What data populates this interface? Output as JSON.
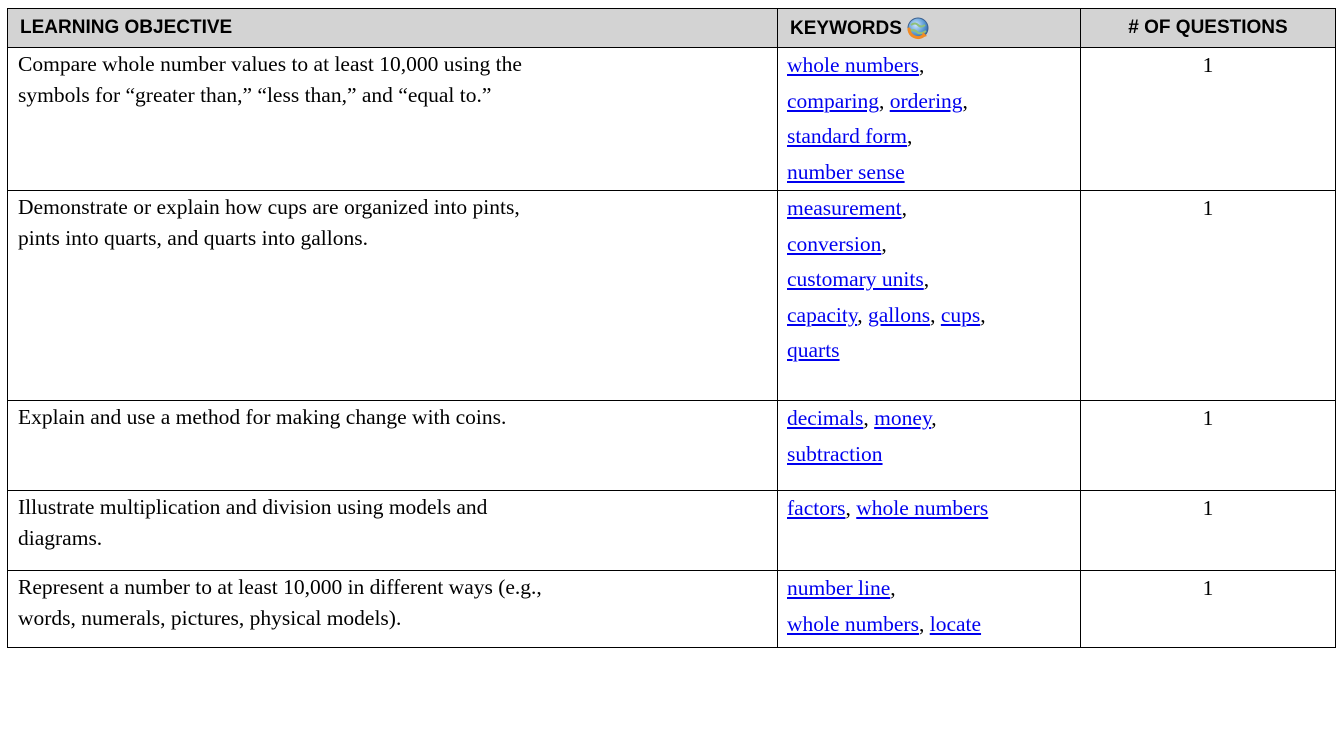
{
  "table": {
    "headers": {
      "objective": "LEARNING OBJECTIVE",
      "keywords": "KEYWORDS",
      "questions": "# OF QUESTIONS"
    },
    "keywords_header_icon": "globe-refresh-icon",
    "colors": {
      "header_bg": "#d3d3d3",
      "link": "#0000ee",
      "border": "#000000"
    },
    "rows": [
      {
        "objective_lines": [
          "Compare whole number values to at least 10,000 using the",
          "symbols for “greater than,” “less than,” and “equal to.”"
        ],
        "keyword_lines": [
          [
            {
              "text": "whole numbers"
            },
            {
              "sep": ","
            }
          ],
          [
            {
              "text": "comparing"
            },
            {
              "sep": ", "
            },
            {
              "text": "ordering"
            },
            {
              "sep": ","
            }
          ],
          [
            {
              "text": "standard form"
            },
            {
              "sep": ","
            }
          ],
          [
            {
              "text": "number sense"
            }
          ]
        ],
        "questions": "1"
      },
      {
        "objective_lines": [
          "Demonstrate or explain how cups are organized into pints,",
          "pints into quarts, and quarts into gallons."
        ],
        "keyword_lines": [
          [
            {
              "text": "measurement"
            },
            {
              "sep": ","
            }
          ],
          [
            {
              "text": "conversion"
            },
            {
              "sep": ","
            }
          ],
          [
            {
              "text": "customary units"
            },
            {
              "sep": ","
            }
          ],
          [
            {
              "text": "capacity"
            },
            {
              "sep": ", "
            },
            {
              "text": "gallons"
            },
            {
              "sep": ", "
            },
            {
              "text": "cups"
            },
            {
              "sep": ","
            }
          ],
          [
            {
              "text": "quarts"
            }
          ]
        ],
        "questions": "1"
      },
      {
        "objective_lines": [
          "Explain and use a method for making change with coins."
        ],
        "keyword_lines": [
          [
            {
              "text": "decimals"
            },
            {
              "sep": ", "
            },
            {
              "text": "money"
            },
            {
              "sep": ","
            }
          ],
          [
            {
              "text": "subtraction"
            }
          ]
        ],
        "questions": "1"
      },
      {
        "objective_lines": [
          "Illustrate multiplication and division using models and",
          "diagrams."
        ],
        "keyword_lines": [
          [
            {
              "text": "factors"
            },
            {
              "sep": ", "
            },
            {
              "text": "whole numbers"
            }
          ]
        ],
        "questions": "1"
      },
      {
        "objective_lines": [
          "Represent a number to at least 10,000 in different ways (e.g.,",
          "words, numerals, pictures, physical models)."
        ],
        "keyword_lines": [
          [
            {
              "text": "number line"
            },
            {
              "sep": ","
            }
          ],
          [
            {
              "text": "whole numbers"
            },
            {
              "sep": ", "
            },
            {
              "text": "locate"
            }
          ]
        ],
        "questions": "1"
      }
    ]
  }
}
